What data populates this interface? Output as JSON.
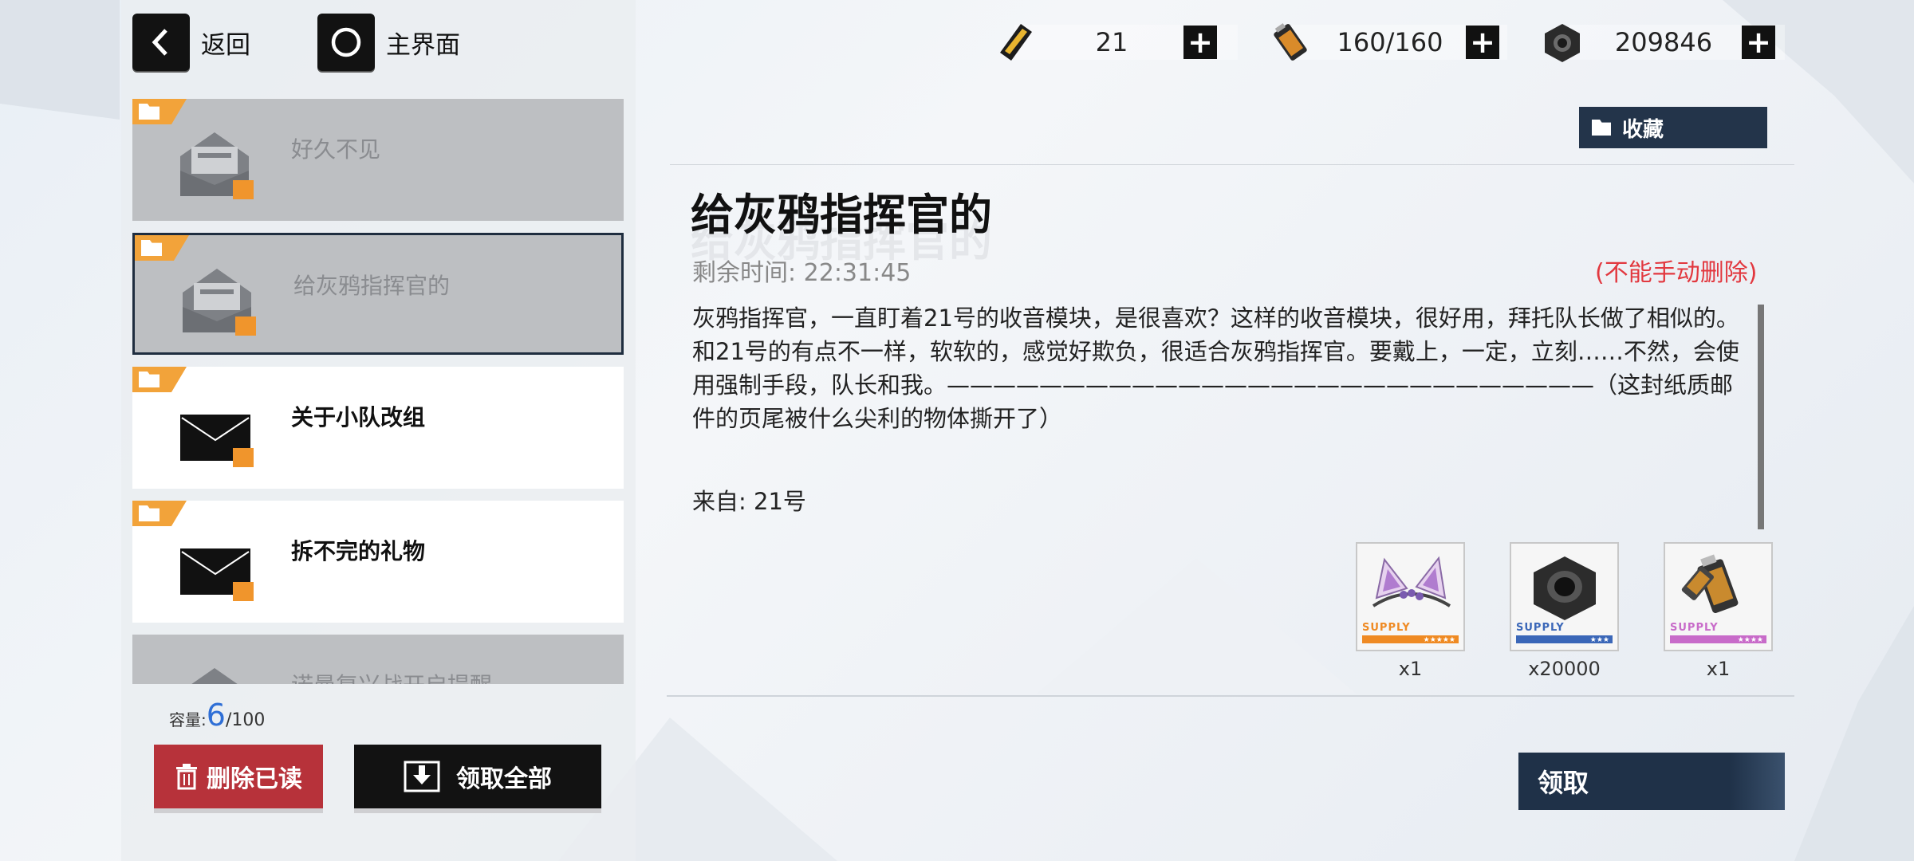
{
  "nav": {
    "back_label": "返回",
    "home_label": "主界面"
  },
  "resources": [
    {
      "icon": "ticket-icon",
      "value": "21"
    },
    {
      "icon": "battery-icon",
      "value": "160/160"
    },
    {
      "icon": "hex-nut-icon",
      "value": "209846"
    }
  ],
  "mail_list": [
    {
      "title": "好久不见",
      "state": "read"
    },
    {
      "title": "给灰鸦指挥官的",
      "state": "read",
      "selected": true
    },
    {
      "title": "关于小队改组",
      "state": "unread"
    },
    {
      "title": "拆不完的礼物",
      "state": "unread"
    },
    {
      "title": "诺曼复兴战开启提醒",
      "state": "read"
    }
  ],
  "capacity": {
    "label": "容量:",
    "current": "6",
    "max": "/100"
  },
  "buttons": {
    "delete_read": "删除已读",
    "claim_all": "领取全部",
    "favorite": "收藏",
    "claim": "领取"
  },
  "detail": {
    "title": "给灰鸦指挥官的",
    "remaining_time": "剩余时间: 22:31:45",
    "no_delete_notice": "(不能手动删除)",
    "body": "灰鸦指挥官，一直盯着21号的收音模块，是很喜欢？这样的收音模块，很好用，拜托队长做了相似的。和21号的有点不一样，软软的，感觉好欺负，很适合灰鸦指挥官。要戴上，一定，立刻……不然，会使用强制手段，队长和我。————————————————————————————（这封纸质邮件的页尾被什么尖利的物体撕开了）",
    "from": "来自: 21号"
  },
  "rewards": [
    {
      "icon": "cat-ear-headband-icon",
      "qty": "x1",
      "supply": "SUPPLY",
      "color": "#ef8a23"
    },
    {
      "icon": "hex-nut-icon",
      "qty": "x20000",
      "supply": "SUPPLY",
      "color": "#3b67b8"
    },
    {
      "icon": "battery-icon",
      "qty": "x1",
      "supply": "SUPPLY",
      "color": "#c86bc9"
    }
  ]
}
